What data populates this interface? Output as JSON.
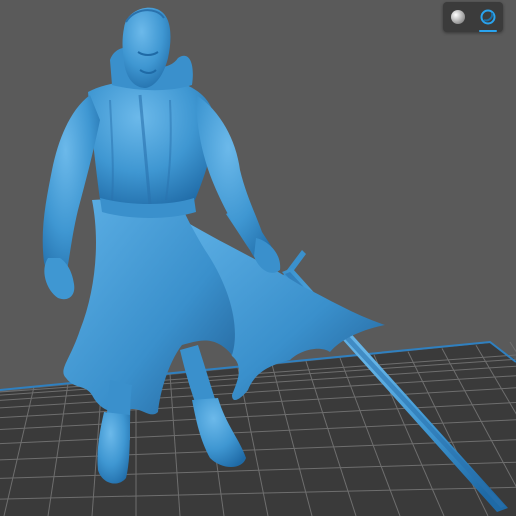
{
  "viewer": {
    "background_color": "#5a5a5a",
    "bed_color": "#3a3a3a",
    "bed_grid_color": "#6e6e6e",
    "bed_border_color": "#2f80c0",
    "model_color": "#4a9fd6"
  },
  "toolbar": {
    "buttons": [
      {
        "icon": "solid-shading-icon",
        "active": false
      },
      {
        "icon": "wireframe-shading-icon",
        "active": true
      }
    ],
    "active_color": "#29a3ef"
  }
}
